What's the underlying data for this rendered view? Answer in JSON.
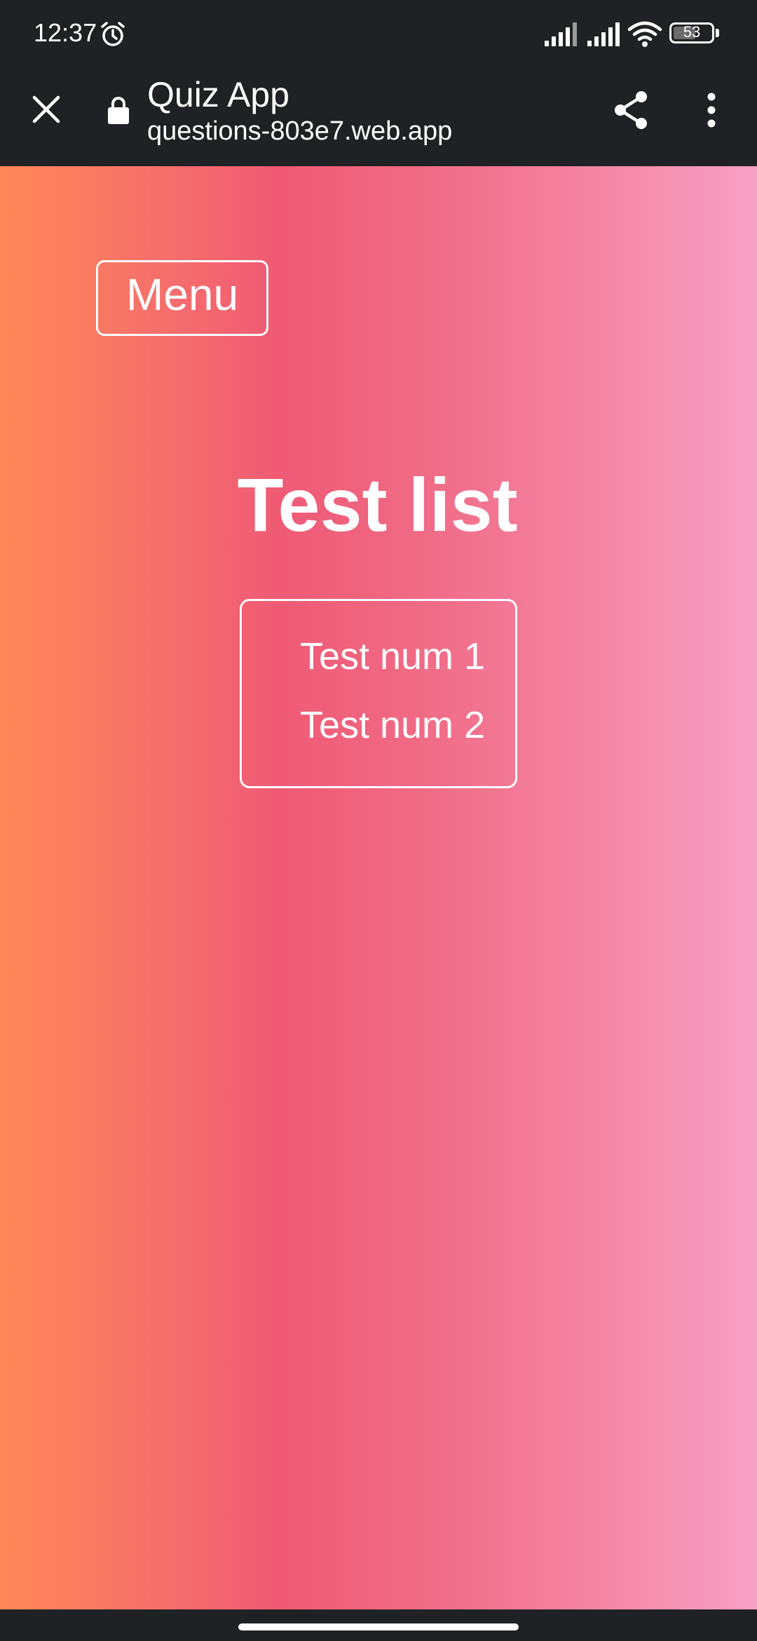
{
  "status_bar": {
    "time": "12:37",
    "battery": "53",
    "battery_level": 0.53,
    "icons": [
      "alarm-icon",
      "signal-icon",
      "signal-icon",
      "wifi-icon",
      "battery-icon"
    ]
  },
  "toolbar": {
    "title": "Quiz App",
    "url": "questions-803e7.web.app",
    "icons": [
      "close-icon",
      "lock-icon",
      "share-icon",
      "more-vert-icon"
    ]
  },
  "page": {
    "menu_label": "Menu",
    "title": "Test list",
    "tests": [
      "Test num 1",
      "Test num 2"
    ]
  },
  "colors": {
    "chrome_background": "#202124",
    "gradient_start": "#ff8757",
    "gradient_mid": "#f05a75",
    "gradient_end": "#f7a1c5",
    "foreground": "#ffffff"
  }
}
